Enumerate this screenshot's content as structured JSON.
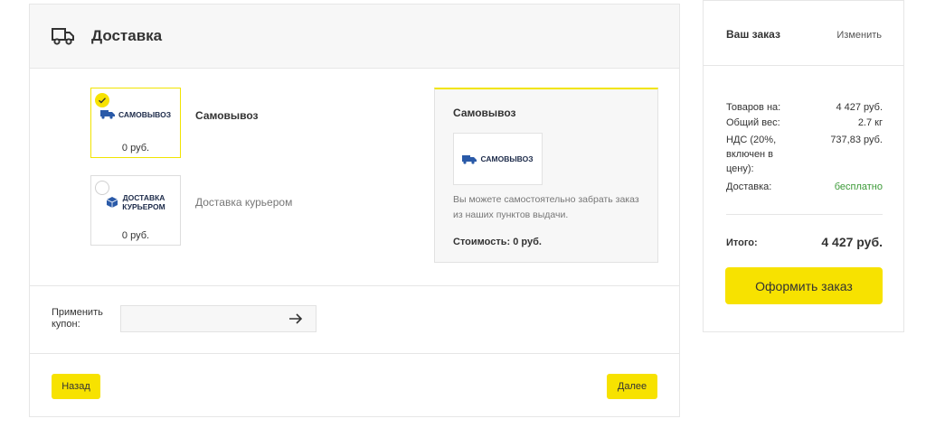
{
  "delivery": {
    "title": "Доставка",
    "options": [
      {
        "logo_text": "САМОВЫВОЗ",
        "price": "0 руб.",
        "label": "Самовывоз",
        "selected": true
      },
      {
        "logo_text_line1": "ДОСТАВКА",
        "logo_text_line2": "КУРЬЕРОМ",
        "price": "0 руб.",
        "label": "Доставка курьером",
        "selected": false
      }
    ],
    "detail": {
      "title": "Самовывоз",
      "logo_text": "САМОВЫВОЗ",
      "description": "Вы можете самостоятельно забрать заказ из наших пунктов выдачи.",
      "cost": "Стоимость: 0 руб."
    },
    "coupon": {
      "label": "Применить купон:",
      "value": ""
    },
    "buttons": {
      "back": "Назад",
      "next": "Далее"
    }
  },
  "order": {
    "title": "Ваш заказ",
    "edit": "Изменить",
    "rows": [
      {
        "key": "Товаров на:",
        "value": "4 427 руб."
      },
      {
        "key": "Общий вес:",
        "value": "2.7 кг"
      },
      {
        "key": "НДС (20%, включен в цену):",
        "value": "737,83 руб."
      },
      {
        "key": "Доставка:",
        "value": "бесплатно"
      }
    ],
    "total_label": "Итого:",
    "total_value": "4 427 руб.",
    "submit": "Оформить заказ"
  },
  "colors": {
    "accent": "#f7e200",
    "free": "#3c9a38",
    "logo": "#1d2b4a"
  }
}
